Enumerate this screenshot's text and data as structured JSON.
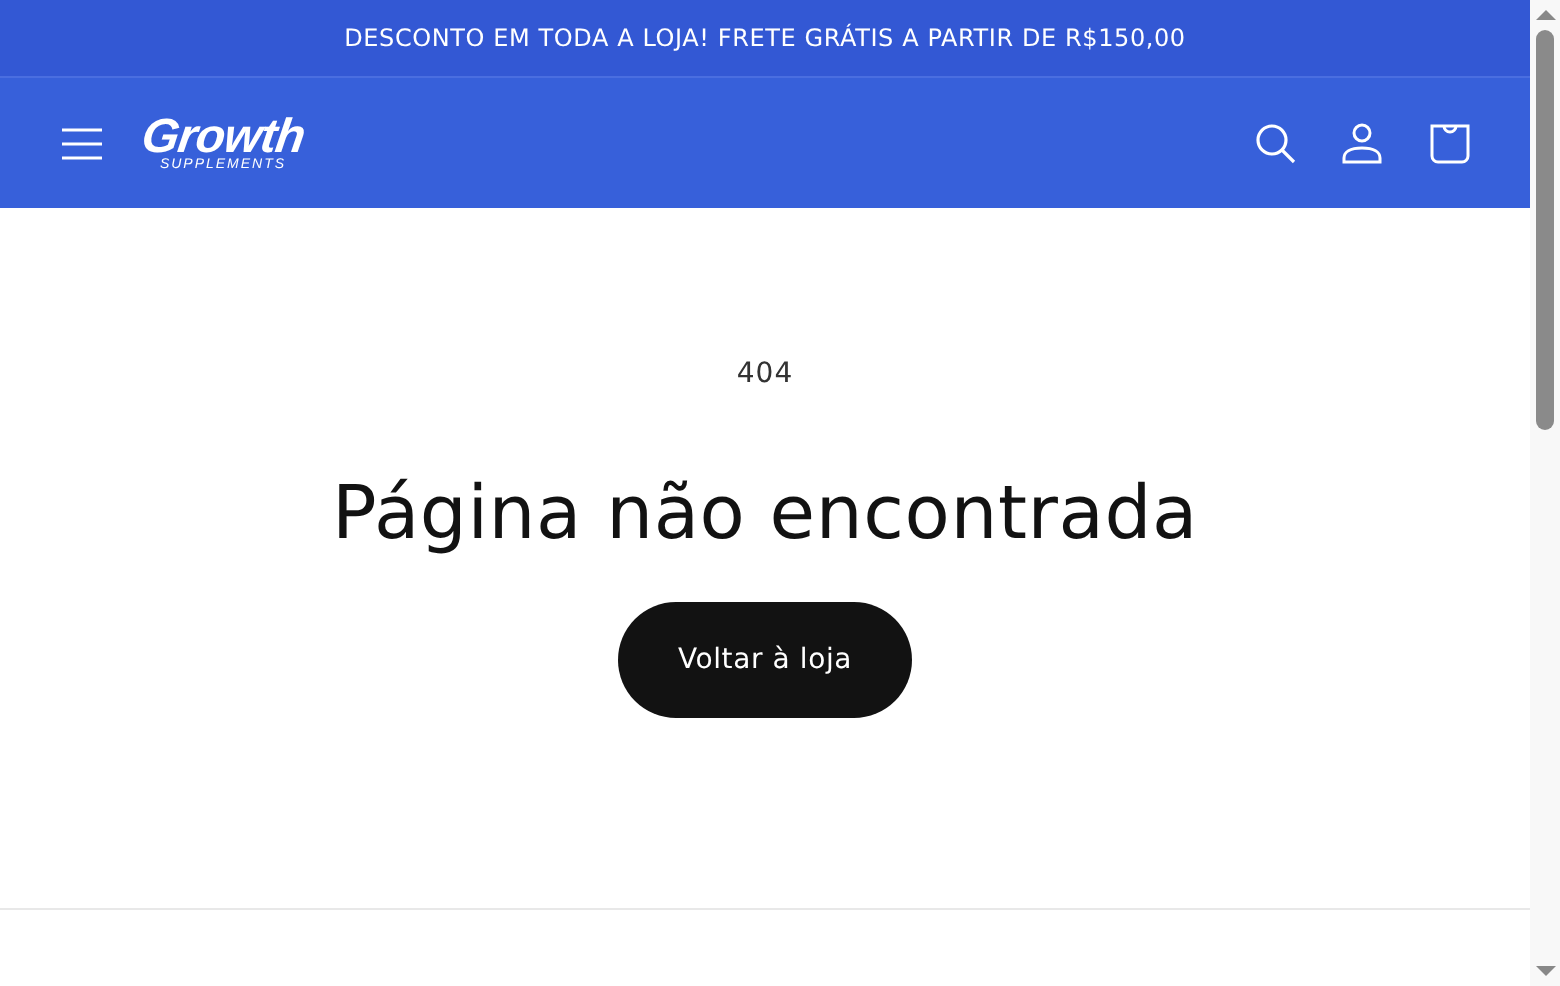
{
  "announcement": "DESCONTO EM TODA A LOJA! FRETE GRÁTIS A PARTIR DE R$150,00",
  "header": {
    "logo": {
      "name": "Growth",
      "tagline": "SUPPLEMENTS"
    }
  },
  "main": {
    "code": "404",
    "title": "Página não encontrada",
    "button": "Voltar à loja"
  }
}
